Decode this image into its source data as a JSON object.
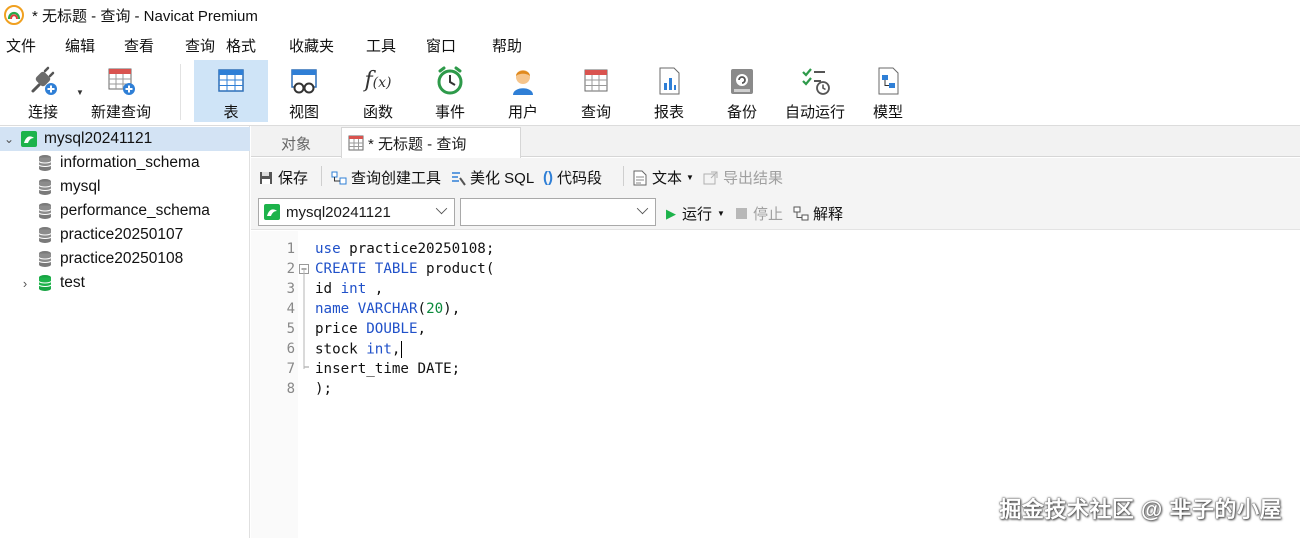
{
  "window": {
    "title": "* 无标题 - 查询 - Navicat Premium"
  },
  "menu": [
    "文件",
    "编辑",
    "查看",
    "查询",
    "格式",
    "收藏夹",
    "工具",
    "窗口",
    "帮助"
  ],
  "toolbar": {
    "items": [
      {
        "label": "连接",
        "icon": "plug-icon"
      },
      {
        "label": "新建查询",
        "icon": "new-query-icon"
      },
      {
        "label": "表",
        "icon": "table-icon",
        "active": true
      },
      {
        "label": "视图",
        "icon": "view-icon"
      },
      {
        "label": "函数",
        "icon": "function-icon"
      },
      {
        "label": "事件",
        "icon": "clock-icon"
      },
      {
        "label": "用户",
        "icon": "user-icon"
      },
      {
        "label": "查询",
        "icon": "query-icon"
      },
      {
        "label": "报表",
        "icon": "report-icon"
      },
      {
        "label": "备份",
        "icon": "backup-icon"
      },
      {
        "label": "自动运行",
        "icon": "automation-icon"
      },
      {
        "label": "模型",
        "icon": "model-icon"
      }
    ]
  },
  "sidebar": {
    "connection": "mysql20241121",
    "databases": [
      {
        "name": "information_schema"
      },
      {
        "name": "mysql"
      },
      {
        "name": "performance_schema"
      },
      {
        "name": "practice20250107"
      },
      {
        "name": "practice20250108"
      },
      {
        "name": "test"
      }
    ]
  },
  "tabs": {
    "objects": "对象",
    "query": "* 无标题 - 查询"
  },
  "query_toolbar": {
    "save": "保存",
    "query_builder": "查询创建工具",
    "beautify": "美化 SQL",
    "snippet": "代码段",
    "text": "文本",
    "export": "导出结果"
  },
  "query_row": {
    "connection_select": "mysql20241121",
    "database_select": "",
    "run": "运行",
    "stop": "停止",
    "explain": "解释"
  },
  "editor": {
    "lines": [
      "1",
      "2",
      "3",
      "4",
      "5",
      "6",
      "7",
      "8"
    ],
    "code": {
      "l1_use": "use",
      "l1_rest": " practice20250108;",
      "l2_create": "CREATE",
      "l2_table": "TABLE",
      "l2_rest": " product(",
      "l3_id": "id ",
      "l3_int": "int",
      "l3_rest": " ,",
      "l4_name": "name",
      "l4_varchar": "VARCHAR",
      "l4_open": "(",
      "l4_num": "20",
      "l4_rest": "),",
      "l5_price": "price ",
      "l5_double": "DOUBLE",
      "l5_rest": ",",
      "l6_stock": "stock ",
      "l6_int": "int",
      "l6_rest": ",",
      "l7": "insert_time DATE;",
      "l8": ");"
    }
  },
  "watermark": "掘金技术社区 @ 芈子的小屋",
  "colors": {
    "accent": "#cfe4f7",
    "keyword": "#2051c9",
    "number": "#0b8a3c",
    "db_green": "#1db34b"
  }
}
